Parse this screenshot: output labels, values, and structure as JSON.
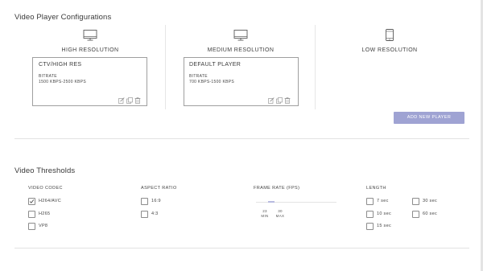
{
  "player_section": {
    "title": "Video Player Configurations",
    "columns": [
      {
        "heading": "HIGH RESOLUTION",
        "icon": "monitor-icon",
        "card": {
          "name": "CTV/HIGH RES",
          "bitrate_label": "BITRATE",
          "bitrate_value": "1500 KBPS-2500 KBPS"
        }
      },
      {
        "heading": "MEDIUM RESOLUTION",
        "icon": "monitor-icon",
        "card": {
          "name": "DEFAULT PLAYER",
          "bitrate_label": "BITRATE",
          "bitrate_value": "700 KBPS-1500 KBPS"
        }
      },
      {
        "heading": "LOW RESOLUTION",
        "icon": "mobile-device-icon",
        "card": null
      }
    ],
    "add_button": "ADD NEW PLAYER"
  },
  "threshold_section": {
    "title": "Video Thresholds",
    "codec": {
      "heading": "VIDEO CODEC",
      "options": [
        {
          "label": "H264/AVC",
          "checked": true
        },
        {
          "label": "H265",
          "checked": false
        },
        {
          "label": "VP8",
          "checked": false
        }
      ]
    },
    "aspect": {
      "heading": "ASPECT RATIO",
      "options": [
        {
          "label": "16:9",
          "checked": false
        },
        {
          "label": "4:3",
          "checked": false
        }
      ]
    },
    "framerate": {
      "heading": "FRAME RATE (FPS)",
      "min_value": "23",
      "min_label": "MIN",
      "max_value": "30",
      "max_label": "MAX"
    },
    "length": {
      "heading": "LENGTH",
      "options": [
        {
          "label": "7 sec",
          "checked": false
        },
        {
          "label": "30 sec",
          "checked": false
        },
        {
          "label": "10 sec",
          "checked": false
        },
        {
          "label": "60 sec",
          "checked": false
        },
        {
          "label": "15 sec",
          "checked": false
        }
      ]
    }
  },
  "colors": {
    "accent_button": "#9fa3d3",
    "slider_range": "#b7bae0"
  }
}
